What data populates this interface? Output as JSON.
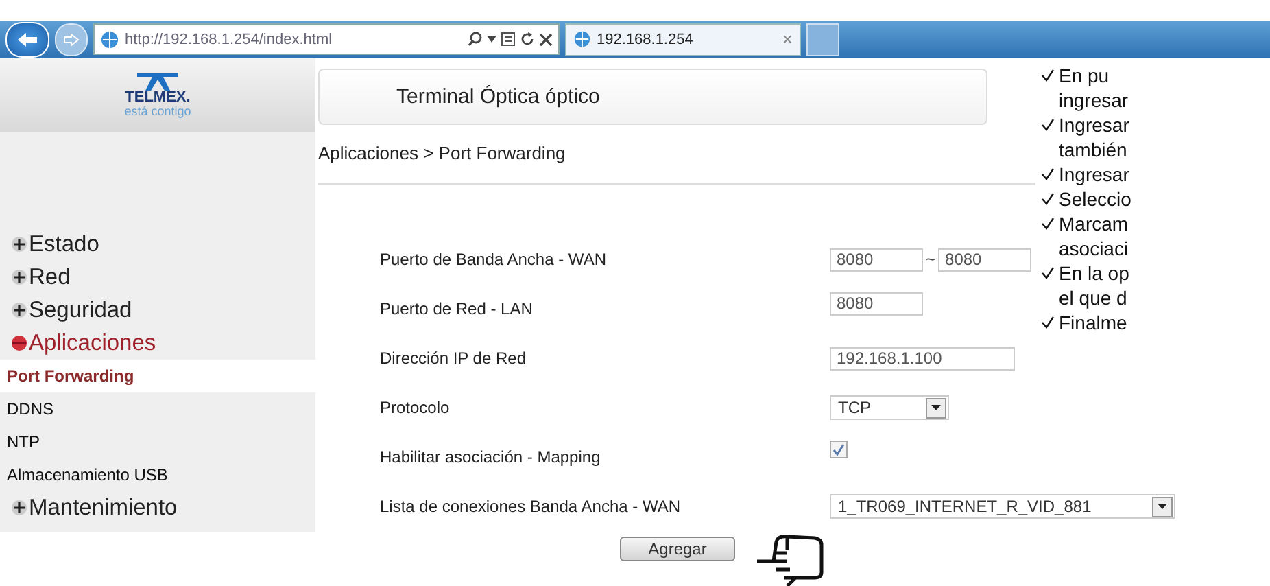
{
  "browser": {
    "address": "http://192.168.1.254/index.html",
    "tab": {
      "title": "192.168.1.254",
      "close": "×"
    }
  },
  "logo": {
    "name": "TELMEX.",
    "slogan": "está contigo"
  },
  "header": {
    "title": "Terminal Óptica óptico"
  },
  "breadcrumb": "Aplicaciones > Port Forwarding",
  "sidebar": {
    "items": [
      {
        "label": "Estado",
        "expanded": false
      },
      {
        "label": "Red",
        "expanded": false
      },
      {
        "label": "Seguridad",
        "expanded": false
      },
      {
        "label": "Aplicaciones",
        "expanded": true,
        "children": [
          {
            "label": "Port Forwarding",
            "selected": true
          },
          {
            "label": "DDNS",
            "selected": false
          },
          {
            "label": "NTP",
            "selected": false
          },
          {
            "label": "Almacenamiento USB",
            "selected": false
          }
        ]
      },
      {
        "label": "Mantenimiento",
        "expanded": false
      }
    ]
  },
  "form": {
    "rows": [
      {
        "label": "Puerto de Banda Ancha - WAN",
        "kind": "range",
        "values": [
          "8080",
          "8080"
        ],
        "separator": "~"
      },
      {
        "label": "Puerto de Red - LAN",
        "kind": "text",
        "value": "8080"
      },
      {
        "label": "Dirección IP de Red",
        "kind": "text",
        "value": "192.168.1.100"
      },
      {
        "label": "Protocolo",
        "kind": "select",
        "value": "TCP"
      },
      {
        "label": "Habilitar asociación - Mapping",
        "kind": "checkbox",
        "checked": true
      },
      {
        "label": "Lista de conexiones Banda Ancha - WAN",
        "kind": "select",
        "value": "1_TR069_INTERNET_R_VID_881"
      }
    ],
    "submit": "Agregar"
  },
  "notes": [
    {
      "lines": [
        "En pu",
        "ingresar"
      ]
    },
    {
      "lines": [
        "Ingresar",
        "también"
      ]
    },
    {
      "lines": [
        "Ingresar"
      ]
    },
    {
      "lines": [
        "Seleccio"
      ]
    },
    {
      "lines": [
        "Marcam",
        "asociaci"
      ]
    },
    {
      "lines": [
        "En la op",
        "el que d"
      ]
    },
    {
      "lines": [
        "Finalme"
      ]
    }
  ]
}
